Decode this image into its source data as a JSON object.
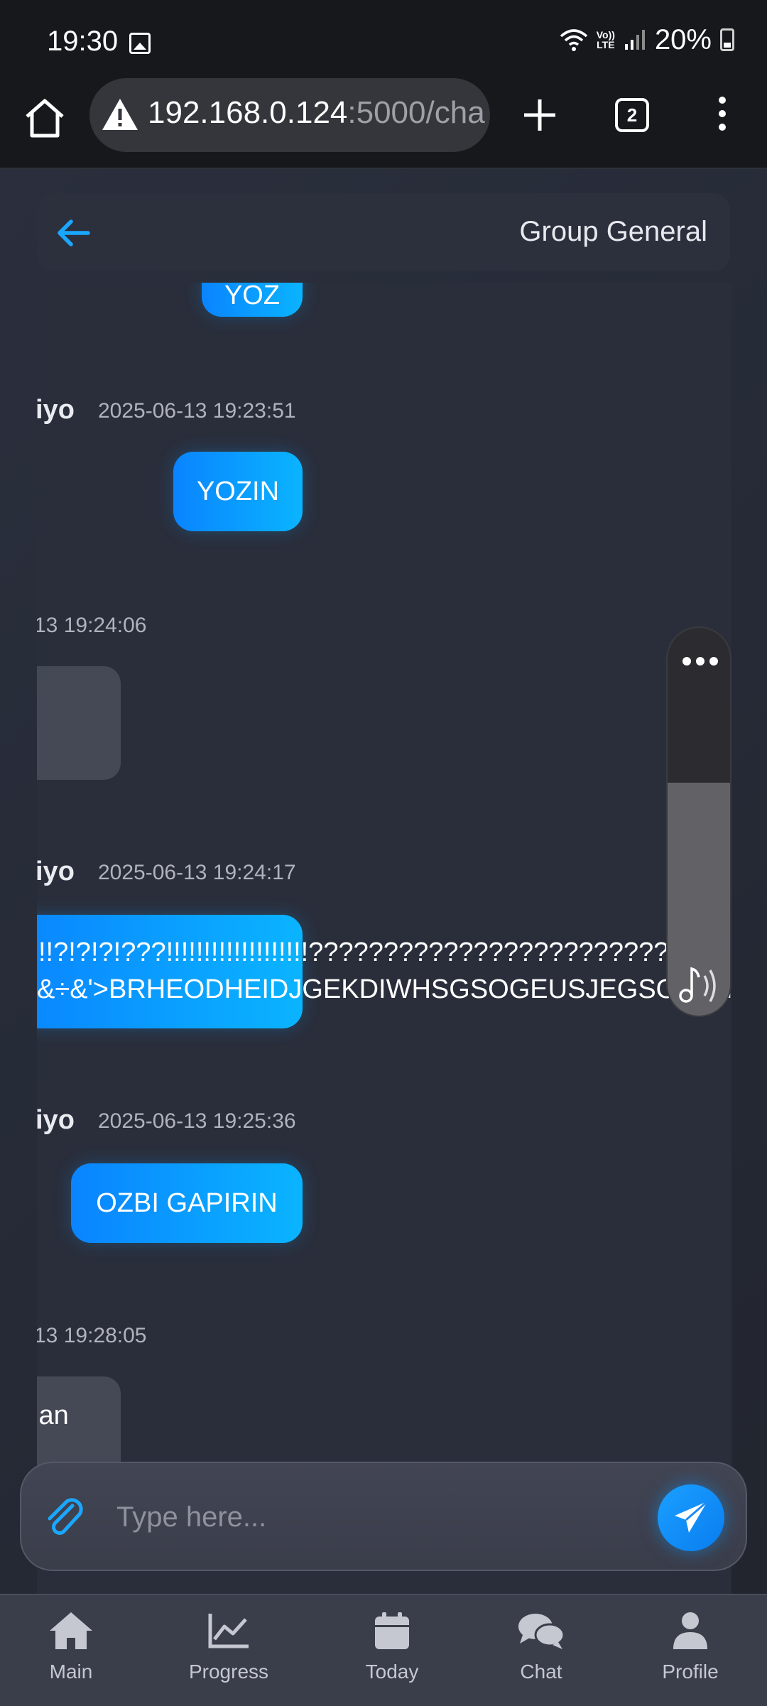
{
  "status_bar": {
    "time": "19:30",
    "network": "LTE",
    "volte": "Vo))",
    "battery": "20%"
  },
  "browser": {
    "url_host": "192.168.0.124",
    "url_rest": ":5000/cha",
    "tab_count": "2"
  },
  "chat": {
    "title": "Group General",
    "messages": [
      {
        "bubble_partial": "YOZ"
      },
      {
        "sender": "iyo",
        "time": "2025-06-13 19:23:51",
        "text": "YOZIN"
      },
      {
        "time_partial": "13 19:24:06"
      },
      {
        "sender": "iyo",
        "time": "2025-06-13 19:24:17",
        "line1": "!!?!?!?!???!!!!!!!!!!!!!!!!!!!????????????????????????????",
        "line2": "&÷&'>BRHEODHEIDJGEKDIWHSGSOGEUSJEGSOKEH"
      },
      {
        "sender": "iyo",
        "time": "2025-06-13 19:25:36",
        "text": "OZBI GAPIRIN"
      },
      {
        "time_partial": "13 19:28:05",
        "text_partial": "lan"
      }
    ]
  },
  "composer": {
    "placeholder": "Type here..."
  },
  "nav": {
    "items": [
      {
        "label": "Main",
        "icon": "home-icon"
      },
      {
        "label": "Progress",
        "icon": "chart-line-icon"
      },
      {
        "label": "Today",
        "icon": "calendar-icon"
      },
      {
        "label": "Chat",
        "icon": "chat-bubbles-icon"
      },
      {
        "label": "Profile",
        "icon": "user-icon"
      }
    ]
  },
  "colors": {
    "accent": "#0aa4ff",
    "background": "#23262f",
    "nav_bg": "#3a3d4a"
  }
}
